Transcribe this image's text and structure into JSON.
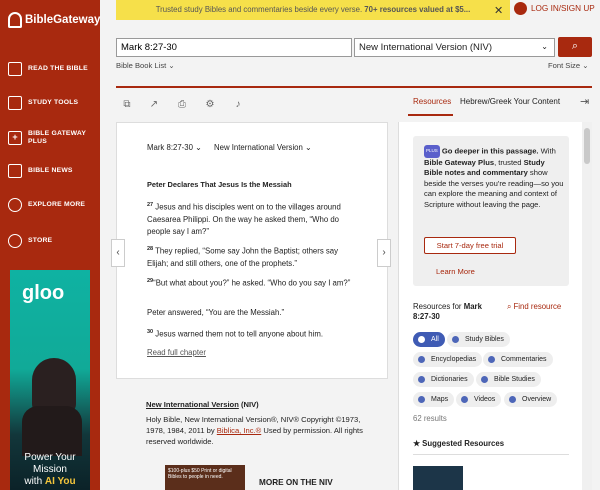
{
  "sidebar": {
    "logo": "BibleGateway",
    "items": [
      {
        "label": "READ THE BIBLE",
        "icon": "book-icon"
      },
      {
        "label": "STUDY TOOLS",
        "icon": "study-icon"
      },
      {
        "label": "BIBLE GATEWAY PLUS",
        "icon": "plus-icon"
      },
      {
        "label": "BIBLE NEWS",
        "icon": "news-icon"
      },
      {
        "label": "EXPLORE MORE",
        "icon": "compass-icon"
      },
      {
        "label": "STORE",
        "icon": "store-icon"
      }
    ],
    "ad": {
      "brand": "gloo",
      "line1": "Power Your",
      "line2": "Mission",
      "line3a": "with ",
      "line3b": "AI You"
    }
  },
  "banner": {
    "text": "Trusted study Bibles and commentaries beside every verse. ",
    "bold": "70+ resources valued at $5..."
  },
  "login": "LOG IN/SIGN UP",
  "search": {
    "value": "Mark 8:27-30",
    "version": "New International Version (NIV)"
  },
  "toolbar": {
    "bible_book_list": "Bible Book List",
    "font_size": "Font Size"
  },
  "tabs": {
    "resources": "Resources",
    "hebrew": "Hebrew/Greek Your Content"
  },
  "passage": {
    "reference": "Mark 8:27-30",
    "version": "New International Version",
    "heading": "Peter Declares That Jesus Is the Messiah",
    "verses": [
      {
        "num": "27",
        "text": "Jesus and his disciples went on to the villages around Caesarea Philippi. On the way he asked them, “Who do people say I am?”"
      },
      {
        "num": "28",
        "text": "They replied, “Some say John the Baptist; others say Elijah; and still others, one of the prophets.”"
      },
      {
        "num": "29",
        "text": "“But what about you?” he asked. “Who do you say I am?”"
      },
      {
        "num": "",
        "text": "Peter answered, “You are the Messiah.”"
      },
      {
        "num": "30",
        "text": "Jesus warned them not to tell anyone about him."
      }
    ],
    "read_full": "Read full chapter"
  },
  "copyright": {
    "title_link": "New International Version",
    "title_suffix": " (NIV)",
    "text": "Holy Bible, New International Version®, NIV® Copyright ©1973, 1978, 1984, 2011 by ",
    "link": "Biblica, Inc.®",
    "text2": " Used by permission. All rights reserved worldwide.",
    "book_blurb": "$100-plus $50 Print or digital Bibles to people in need.",
    "more": "MORE ON THE NIV"
  },
  "promo": {
    "badge": "PLUS",
    "bold1": "Go deeper in this passage.",
    "t1": " With ",
    "bold2": "Bible Gateway Plus",
    "t2": ", trusted ",
    "bold3": "Study Bible notes and commentary",
    "t3": " show beside the verses you're reading—so you can explore the meaning and context of Scripture without leaving the page.",
    "trial": "Start 7-day free trial",
    "learn": "Learn More"
  },
  "resources": {
    "for_label": "Resources for ",
    "for_ref": "Mark 8:27-30",
    "find": "Find resource",
    "chips": [
      "All",
      "Study Bibles",
      "Encyclopedias",
      "Commentaries",
      "Dictionaries",
      "Bible Studies",
      "Maps",
      "Videos",
      "Overview"
    ],
    "results": "62 results",
    "suggested": "Suggested Resources"
  }
}
